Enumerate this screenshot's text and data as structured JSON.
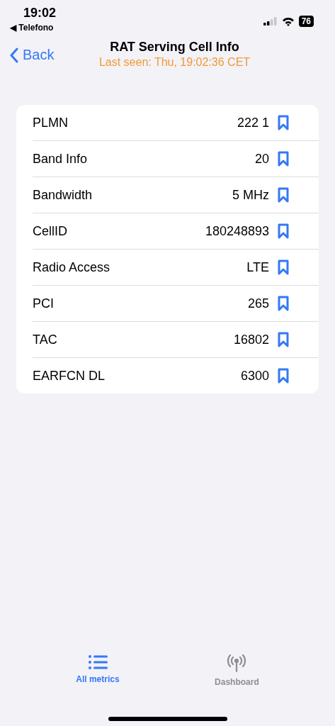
{
  "status_bar": {
    "time": "19:02",
    "back_app": "◀ Telefono",
    "battery": "76"
  },
  "nav": {
    "back": "Back",
    "title": "RAT Serving Cell Info",
    "subtitle": "Last seen: Thu, 19:02:36 CET"
  },
  "rows": [
    {
      "label": "PLMN",
      "value": "222 1"
    },
    {
      "label": "Band Info",
      "value": "20"
    },
    {
      "label": "Bandwidth",
      "value": "5 MHz"
    },
    {
      "label": "CellID",
      "value": "180248893"
    },
    {
      "label": "Radio Access",
      "value": "LTE"
    },
    {
      "label": "PCI",
      "value": "265"
    },
    {
      "label": "TAC",
      "value": "16802"
    },
    {
      "label": "EARFCN DL",
      "value": "6300"
    }
  ],
  "tabs": [
    {
      "label": "All metrics",
      "kind": "list",
      "selected": true
    },
    {
      "label": "Dashboard",
      "kind": "antenna",
      "selected": false
    }
  ]
}
